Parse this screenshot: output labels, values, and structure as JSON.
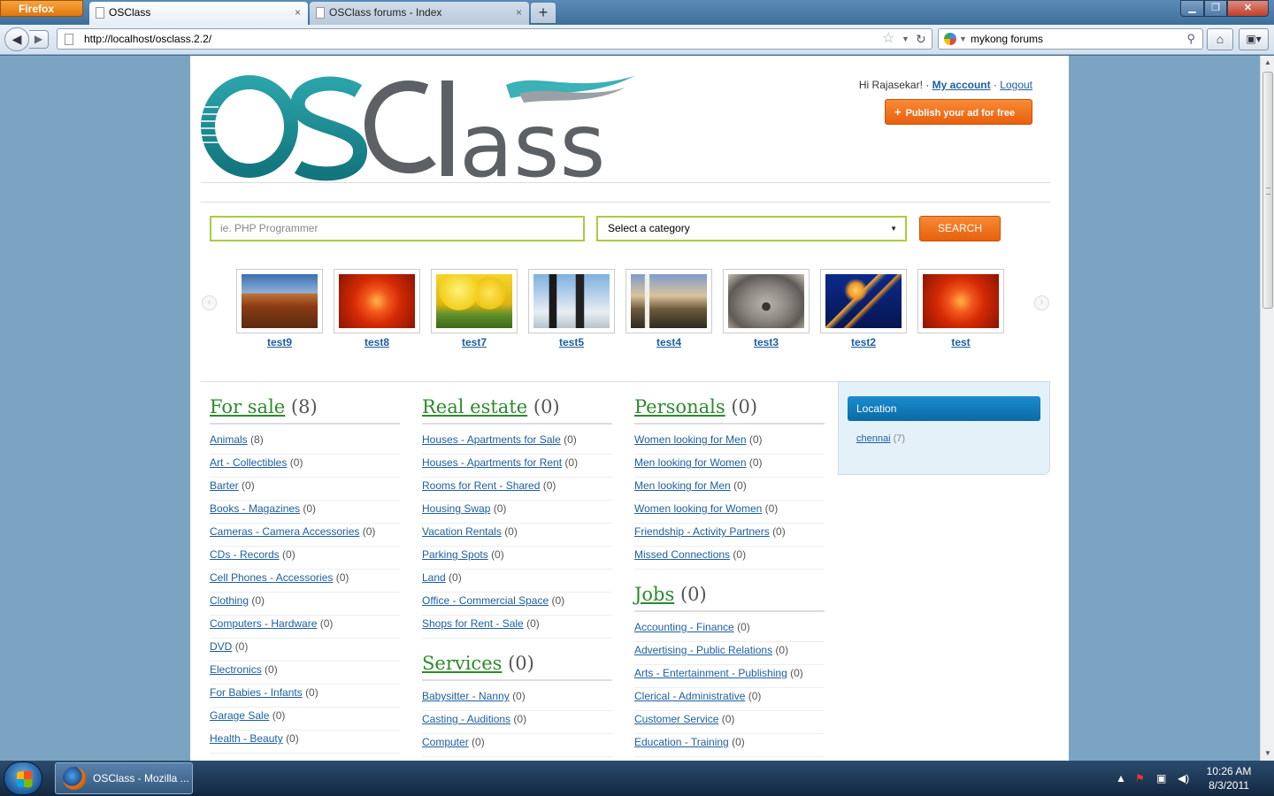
{
  "browser": {
    "menu_label": "Firefox",
    "tabs": [
      {
        "label": "OSClass",
        "close": "×"
      },
      {
        "label": "OSClass forums - Index",
        "close": "×"
      }
    ],
    "new_tab": "+",
    "window_buttons": {
      "minimize": "▁",
      "maximize": "❐",
      "close": "✕"
    },
    "url": "http://localhost/osclass.2.2/",
    "search_value": "mykong forums"
  },
  "header": {
    "greeting": "Hi Rajasekar! ·",
    "my_account": "My account",
    "separator": "·",
    "logout": "Logout",
    "publish_label": "Publish your ad for free",
    "logo_text_os": "OS",
    "logo_text_class": "Class"
  },
  "search": {
    "placeholder": "ie. PHP Programmer",
    "category_selected": "Select a category",
    "button_label": "SEARCH"
  },
  "carousel": {
    "items": [
      {
        "label": "test9",
        "icon": "desert-image"
      },
      {
        "label": "test8",
        "icon": "flower-image"
      },
      {
        "label": "test7",
        "icon": "tulips-image"
      },
      {
        "label": "test5",
        "icon": "penguins-image"
      },
      {
        "label": "test4",
        "icon": "lighthouse-image"
      },
      {
        "label": "test3",
        "icon": "koala-image"
      },
      {
        "label": "test2",
        "icon": "jellyfish-image"
      },
      {
        "label": "test",
        "icon": "flower-image"
      }
    ]
  },
  "categories": {
    "for_sale": {
      "title": "For sale",
      "count": "(8)",
      "items": [
        {
          "label": "Animals",
          "count": "(8)"
        },
        {
          "label": "Art - Collectibles",
          "count": "(0)"
        },
        {
          "label": "Barter",
          "count": "(0)"
        },
        {
          "label": "Books - Magazines",
          "count": "(0)"
        },
        {
          "label": "Cameras - Camera Accessories",
          "count": "(0)"
        },
        {
          "label": "CDs - Records",
          "count": "(0)"
        },
        {
          "label": "Cell Phones - Accessories",
          "count": "(0)"
        },
        {
          "label": "Clothing",
          "count": "(0)"
        },
        {
          "label": "Computers - Hardware",
          "count": "(0)"
        },
        {
          "label": "DVD",
          "count": "(0)"
        },
        {
          "label": "Electronics",
          "count": "(0)"
        },
        {
          "label": "For Babies - Infants",
          "count": "(0)"
        },
        {
          "label": "Garage Sale",
          "count": "(0)"
        },
        {
          "label": "Health - Beauty",
          "count": "(0)"
        }
      ]
    },
    "real_estate": {
      "title": "Real estate",
      "count": "(0)",
      "items": [
        {
          "label": "Houses - Apartments for Sale",
          "count": "(0)"
        },
        {
          "label": "Houses - Apartments for Rent",
          "count": "(0)"
        },
        {
          "label": "Rooms for Rent - Shared",
          "count": "(0)"
        },
        {
          "label": "Housing Swap",
          "count": "(0)"
        },
        {
          "label": "Vacation Rentals",
          "count": "(0)"
        },
        {
          "label": "Parking Spots",
          "count": "(0)"
        },
        {
          "label": "Land",
          "count": "(0)"
        },
        {
          "label": "Office - Commercial Space",
          "count": "(0)"
        },
        {
          "label": "Shops for Rent - Sale",
          "count": "(0)"
        }
      ]
    },
    "services": {
      "title": "Services",
      "count": "(0)",
      "items": [
        {
          "label": "Babysitter - Nanny",
          "count": "(0)"
        },
        {
          "label": "Casting - Auditions",
          "count": "(0)"
        },
        {
          "label": "Computer",
          "count": "(0)"
        }
      ]
    },
    "personals": {
      "title": "Personals",
      "count": "(0)",
      "items": [
        {
          "label": "Women looking for Men",
          "count": "(0)"
        },
        {
          "label": "Men looking for Women",
          "count": "(0)"
        },
        {
          "label": "Men looking for Men",
          "count": "(0)"
        },
        {
          "label": "Women looking for Women",
          "count": "(0)"
        },
        {
          "label": "Friendship - Activity Partners",
          "count": "(0)"
        },
        {
          "label": "Missed Connections",
          "count": "(0)"
        }
      ]
    },
    "jobs": {
      "title": "Jobs",
      "count": "(0)",
      "items": [
        {
          "label": "Accounting - Finance",
          "count": "(0)"
        },
        {
          "label": "Advertising - Public Relations",
          "count": "(0)"
        },
        {
          "label": "Arts - Entertainment - Publishing",
          "count": "(0)"
        },
        {
          "label": "Clerical - Administrative",
          "count": "(0)"
        },
        {
          "label": "Customer Service",
          "count": "(0)"
        },
        {
          "label": "Education - Training",
          "count": "(0)"
        }
      ]
    }
  },
  "location": {
    "title": "Location",
    "items": [
      {
        "label": "chennai",
        "count": "(7)"
      }
    ]
  },
  "taskbar": {
    "app_label": "OSClass - Mozilla ...",
    "time": "10:26 AM",
    "date": "8/3/2011"
  },
  "colors": {
    "accent_orange": "#e8600d",
    "link_blue": "#1d5fa0",
    "category_green": "#2d8a2d",
    "input_border": "#a9cc3e",
    "location_blue": "#0b6aa6"
  }
}
